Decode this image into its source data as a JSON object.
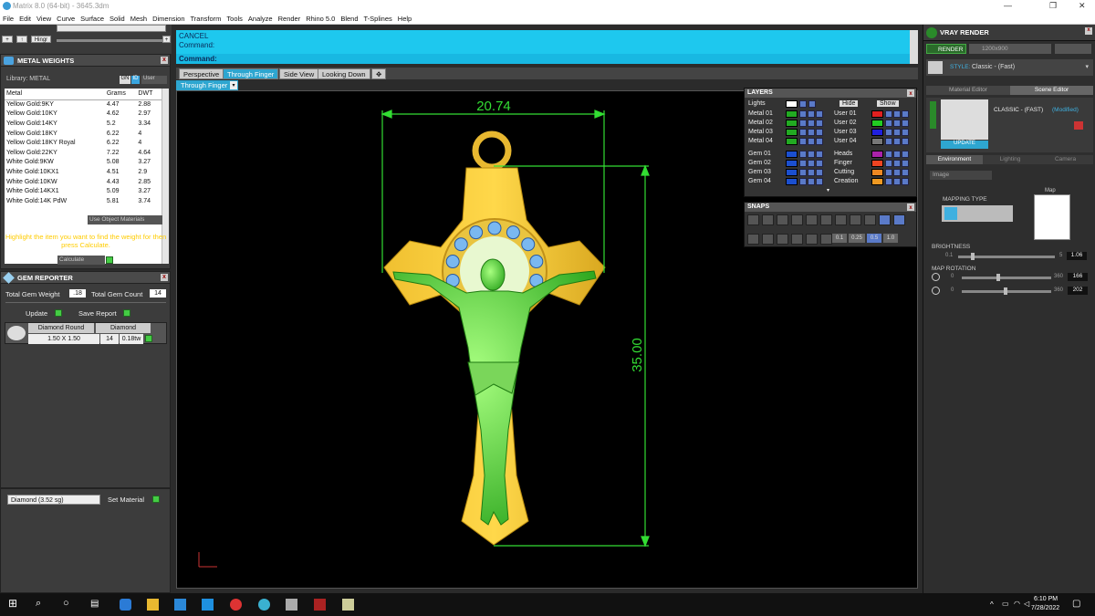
{
  "window": {
    "title": "Matrix 8.0 (64-bit) - 3645.3dm",
    "controls": [
      "—",
      "❐",
      "✕"
    ]
  },
  "menu": [
    "File",
    "Edit",
    "View",
    "Curve",
    "Surface",
    "Solid",
    "Mesh",
    "Dimension",
    "Transform",
    "Tools",
    "Analyze",
    "Render",
    "Rhino 5.0",
    "Blend",
    "T-Splines",
    "Help"
  ],
  "toolbar": {
    "hinge_label": "Hingr"
  },
  "metal_weights": {
    "title": "METAL WEIGHTS",
    "library": "Library: METAL",
    "unit_opts": [
      "GN",
      "ID",
      "User"
    ],
    "columns": [
      "Metal",
      "Grams",
      "DWT"
    ],
    "rows": [
      [
        "Yellow Gold:9KY",
        "4.47",
        "2.88"
      ],
      [
        "Yellow Gold:10KY",
        "4.62",
        "2.97"
      ],
      [
        "Yellow Gold:14KY",
        "5.2",
        "3.34"
      ],
      [
        "Yellow Gold:18KY",
        "6.22",
        "4"
      ],
      [
        "Yellow Gold:18KY Royal",
        "6.22",
        "4"
      ],
      [
        "Yellow Gold:22KY",
        "7.22",
        "4.64"
      ],
      [
        "White Gold:9KW",
        "5.08",
        "3.27"
      ],
      [
        "White Gold:10KX1",
        "4.51",
        "2.9"
      ],
      [
        "White Gold:10KW",
        "4.43",
        "2.85"
      ],
      [
        "White Gold:14KX1",
        "5.09",
        "3.27"
      ],
      [
        "White Gold:14K PdW",
        "5.81",
        "3.74"
      ]
    ],
    "use_object_label": "Use Object Materials",
    "hint": "Highlight the item you want to find the weight for then press Calculate.",
    "calc_label": "Calculate"
  },
  "gem_reporter": {
    "title": "GEM REPORTER",
    "total_weight_label": "Total Gem Weight",
    "total_weight": ".18",
    "total_count_label": "Total Gem Count",
    "total_count": "14",
    "update_label": "Update",
    "save_label": "Save Report",
    "gem": {
      "shape": "Diamond Round",
      "size": "1.50 X 1.50",
      "material": "Diamond",
      "count": "14",
      "weight": "0.18tw"
    }
  },
  "material_select": {
    "value": "Diamond    (3.52 sg)",
    "set_label": "Set Material"
  },
  "command": {
    "line1": "CANCEL",
    "line2": "Command:",
    "line3": "Command:"
  },
  "view_tabs": [
    "Perspective",
    "Through Finger",
    "Side View",
    "Looking Down",
    "✥"
  ],
  "active_view": "Through Finger",
  "dimensions": {
    "width": "20.74",
    "height": "35.00"
  },
  "layers": {
    "title": "LAYERS",
    "lights": "Lights",
    "hide": "Hide",
    "show": "Show",
    "left": [
      {
        "name": "Metal 01",
        "color": "#22aa22"
      },
      {
        "name": "Metal 02",
        "color": "#22aa22"
      },
      {
        "name": "Metal 03",
        "color": "#22aa22"
      },
      {
        "name": "Metal 04",
        "color": "#22aa22"
      },
      {
        "name": "Gem 01",
        "color": "#1b4fcf"
      },
      {
        "name": "Gem 02",
        "color": "#1b4fcf"
      },
      {
        "name": "Gem 03",
        "color": "#1b4fcf"
      },
      {
        "name": "Gem 04",
        "color": "#1b4fcf"
      }
    ],
    "right": [
      {
        "name": "User 01",
        "color": "#e02020"
      },
      {
        "name": "User 02",
        "color": "#22cc22"
      },
      {
        "name": "User 03",
        "color": "#2020dd"
      },
      {
        "name": "User 04",
        "color": "#777777"
      },
      {
        "name": "Heads",
        "color": "#aa22aa"
      },
      {
        "name": "Finger",
        "color": "#ee4422"
      },
      {
        "name": "Cutting",
        "color": "#ee8822"
      },
      {
        "name": "Creation",
        "color": "#ee9922"
      }
    ]
  },
  "snaps": {
    "title": "SNAPS",
    "values": [
      "0.1",
      "0.25",
      "0.5",
      "1.0"
    ]
  },
  "vray": {
    "title": "VRAY RENDER",
    "render_label": "RENDER",
    "size": "1200x900",
    "style_label": "STYLE:",
    "style": "Classic - (Fast)",
    "tabs": [
      "Material Editor",
      "Scene Editor"
    ],
    "preset": "CLASSIC - (FAST)",
    "modified": "(Modified)",
    "update": "UPDATE",
    "env_tabs": [
      "Environment",
      "Lighting",
      "Camera"
    ],
    "env_select": "Image",
    "mapping_label": "MAPPING TYPE",
    "map_label": "Map",
    "brightness_label": "BRIGHTNESS",
    "brightness_min": "0.1",
    "brightness_max": "5",
    "brightness": "1.06",
    "rotation_label": "MAP ROTATION",
    "rot1_min": "0",
    "rot1_max": "360",
    "rot1": "166",
    "rot2_min": "0",
    "rot2_max": "360",
    "rot2": "202"
  },
  "taskbar": {
    "time": "6:10 PM",
    "date": "7/28/2022"
  }
}
